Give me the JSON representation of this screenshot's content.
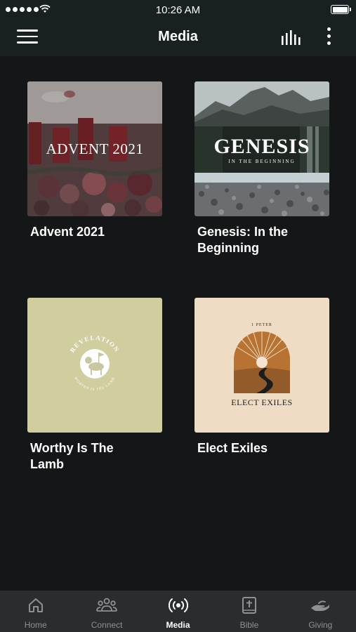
{
  "status_bar": {
    "time": "10:26 AM"
  },
  "header": {
    "title": "Media"
  },
  "media_items": [
    {
      "title": "Advent 2021",
      "thumb_text": "ADVENT 2021"
    },
    {
      "title": "Genesis: In the Beginning",
      "thumb_text": "GENESIS",
      "thumb_subtext": "IN THE BEGINNING"
    },
    {
      "title": "Worthy Is The Lamb",
      "thumb_text": "REVELATION",
      "thumb_subtext": "WORTHY IS THE LAMB"
    },
    {
      "title": "Elect Exiles",
      "thumb_text": "ELECT EXILES",
      "thumb_subtext": "1 PETER"
    }
  ],
  "tabs": [
    {
      "label": "Home",
      "icon": "home-icon",
      "active": false
    },
    {
      "label": "Connect",
      "icon": "people-icon",
      "active": false
    },
    {
      "label": "Media",
      "icon": "broadcast-icon",
      "active": true
    },
    {
      "label": "Bible",
      "icon": "bible-icon",
      "active": false
    },
    {
      "label": "Giving",
      "icon": "giving-hand-icon",
      "active": false
    }
  ],
  "colors": {
    "background": "#141617",
    "nav": "#182021",
    "tab_bar": "#2a2d2f",
    "inactive_tab": "#8d9193"
  }
}
